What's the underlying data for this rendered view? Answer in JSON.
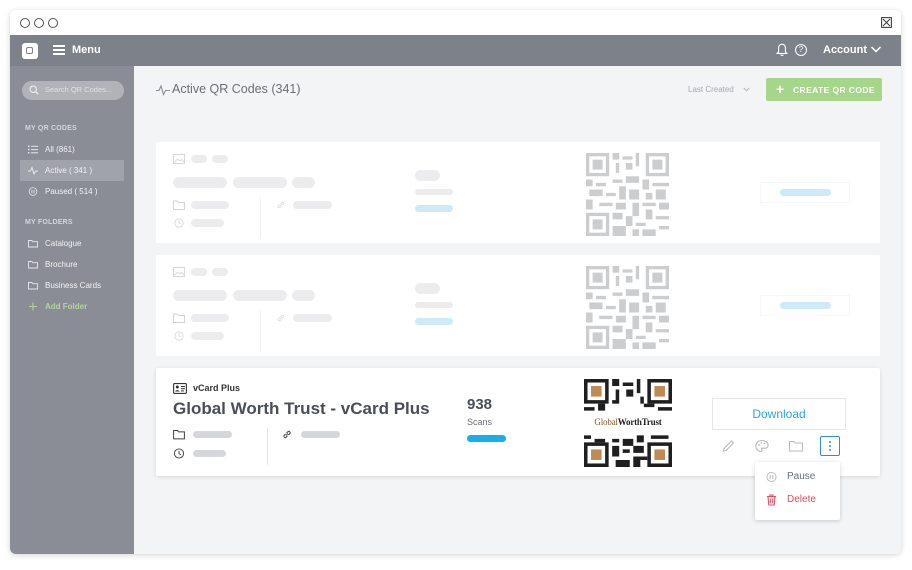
{
  "window": {
    "controls": [
      "circle",
      "circle",
      "circle"
    ]
  },
  "topbar": {
    "menu_label": "Menu",
    "account_label": "Account",
    "help_glyph": "?"
  },
  "sidebar": {
    "search_placeholder": "Search QR Codes...",
    "my_qr_codes_heading": "MY QR CODES",
    "qr_items": [
      {
        "label": "All (861)",
        "icon": "list-icon",
        "active": false
      },
      {
        "label": "Active ( 341 )",
        "icon": "activity-icon",
        "active": true
      },
      {
        "label": "Paused ( 514 )",
        "icon": "pause-circle-icon",
        "active": false
      }
    ],
    "my_folders_heading": "MY FOLDERS",
    "folders": [
      {
        "label": "Catalogue"
      },
      {
        "label": "Brochure"
      },
      {
        "label": "Business Cards"
      }
    ],
    "add_folder_label": "Add Folder"
  },
  "main": {
    "title": "Active QR Codes (341)",
    "sort_label": "Last Created",
    "create_button_label": "CREATE QR CODE",
    "active_card": {
      "type_label": "vCard Plus",
      "title": "Global Worth Trust - vCard Plus",
      "scans_count": "938",
      "scans_label": "Scans",
      "download_label": "Download",
      "qr_logo_text_1": "Global",
      "qr_logo_text_2": "WorthTrust"
    },
    "dropdown": {
      "pause_label": "Pause",
      "delete_label": "Delete"
    }
  },
  "colors": {
    "topbar": "#7d8189",
    "sidebar": "#8a8d95",
    "accent_green": "#a6d68a",
    "download_blue": "#23a8df",
    "scan_bar": "#18aee6",
    "delete_red": "#e94b5b"
  }
}
